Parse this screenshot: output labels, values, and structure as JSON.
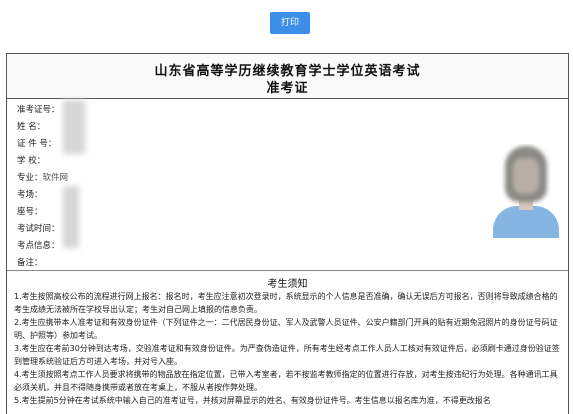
{
  "toolbar": {
    "print_label": "打印"
  },
  "ticket": {
    "title_line1": "山东省高等学历继续教育学士学位英语考试",
    "title_line2": "准考证",
    "fields": [
      {
        "label": "准考证号：",
        "value": ""
      },
      {
        "label": "姓 名：",
        "value": ""
      },
      {
        "label": "证 件 号：",
        "value": ""
      },
      {
        "label": "学 校：",
        "value": ""
      },
      {
        "label": "专业：",
        "value": "软件网"
      },
      {
        "label": "考场：",
        "value": ""
      },
      {
        "label": "座号：",
        "value": ""
      },
      {
        "label": "考试时间：",
        "value": ""
      },
      {
        "label": "考点信息：",
        "value": ""
      },
      {
        "label": "备注：",
        "value": ""
      }
    ]
  },
  "notes": {
    "title": "考生须知",
    "items": [
      "1.考生按照高校公布的流程进行网上报名：报名时，考生应注意初次登录时，系统显示的个人信息是否准确，确认无误后方可报名，否则将导致成绩合格的考生成绩无法被所在学校导出认定；考生对自己网上填报的信息负责。",
      "2.考生应携带本人准考证和有效身份证件（下列证件之一：二代居民身份证、军人及武警人员证件、公安户籍部门开具的贴有近期免冠照片的身份证号码证明、护照等）参加考试。",
      "3.考生应在考前30分钟到达考场，交验准考证和有效身份证件。为严查伪造证件，所有考生经考点工作人员人工核对有效证件后，必须刷卡通过身份验证签到管理系统验证后方可进入考场，并对号入座。",
      "4.考生须按照考点工作人员要求将携带的物品放在指定位置，已带入考室者，若不按监考教师指定的位置进行存放，对考生按违纪行为处理。各种通讯工具必须关机，并且不得随身携带或者放在考桌上，不服从者按作弊处理。",
      "5.考生提前5分钟在考试系统中输入自己的准考证号，并核对屏幕显示的姓名、有效身份证件号。考生信息以报名库为准，不得更改报名"
    ]
  }
}
